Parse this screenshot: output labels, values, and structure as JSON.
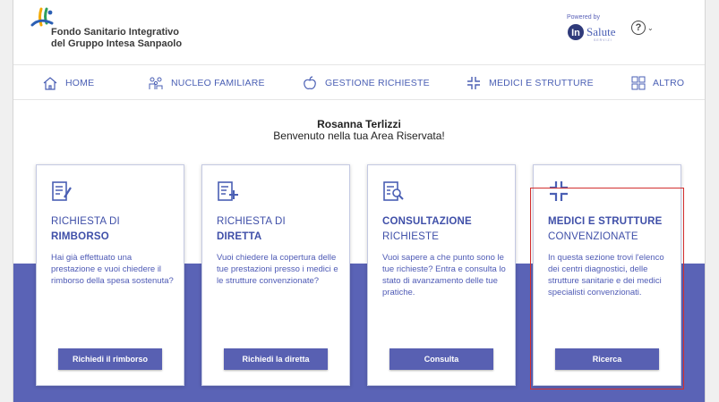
{
  "header": {
    "brand_line1": "Fondo Sanitario Integrativo",
    "brand_line2": "del Gruppo Intesa Sanpaolo",
    "powered_by": "Powered by",
    "partner_logo_text": "Salute",
    "partner_logo_sub": "SERVIZI",
    "help_icon": "question-circle-icon",
    "help_symbol": "?"
  },
  "nav": {
    "items": [
      {
        "label": "HOME",
        "icon": "home-icon"
      },
      {
        "label": "NUCLEO FAMILIARE",
        "icon": "family-icon"
      },
      {
        "label": "GESTIONE RICHIESTE",
        "icon": "apple-icon"
      },
      {
        "label": "MEDICI E STRUTTURE",
        "icon": "medical-cross-icon"
      },
      {
        "label": "ALTRO",
        "icon": "grid-icon"
      }
    ]
  },
  "welcome": {
    "name": "Rosanna Terlizzi",
    "message": "Benvenuto nella tua Area Riservata!"
  },
  "cards": [
    {
      "title_normal": "RICHIESTA DI",
      "title_bold": "RIMBORSO",
      "description": "Hai già effettuato una prestazione e vuoi chiedere il rimborso della spesa sostenuta?",
      "button": "Richiedi il rimborso",
      "icon": "edit-document-icon"
    },
    {
      "title_normal": "RICHIESTA DI",
      "title_bold": "DIRETTA",
      "description": "Vuoi chiedere la copertura delle tue prestazioni presso i medici e le strutture convenzionate?",
      "button": "Richiedi la diretta",
      "icon": "add-document-icon"
    },
    {
      "title_bold": "CONSULTAZIONE",
      "title_normal": "RICHIESTE",
      "description": "Vuoi sapere a che punto sono le tue richieste? Entra e consulta lo stato di avanzamento delle tue pratiche.",
      "button": "Consulta",
      "icon": "search-document-icon"
    },
    {
      "title_bold": "MEDICI E STRUTTURE",
      "title_normal": "CONVENZIONATE",
      "description": "In questa sezione trovi l'elenco dei centri diagnostici, delle strutture sanitarie e dei medici specialisti convenzionati.",
      "button": "Ricerca",
      "icon": "medical-cross-icon"
    }
  ],
  "colors": {
    "accent": "#5a63b6",
    "nav_text": "#4a5fb4",
    "highlight": "#d32f2f"
  }
}
